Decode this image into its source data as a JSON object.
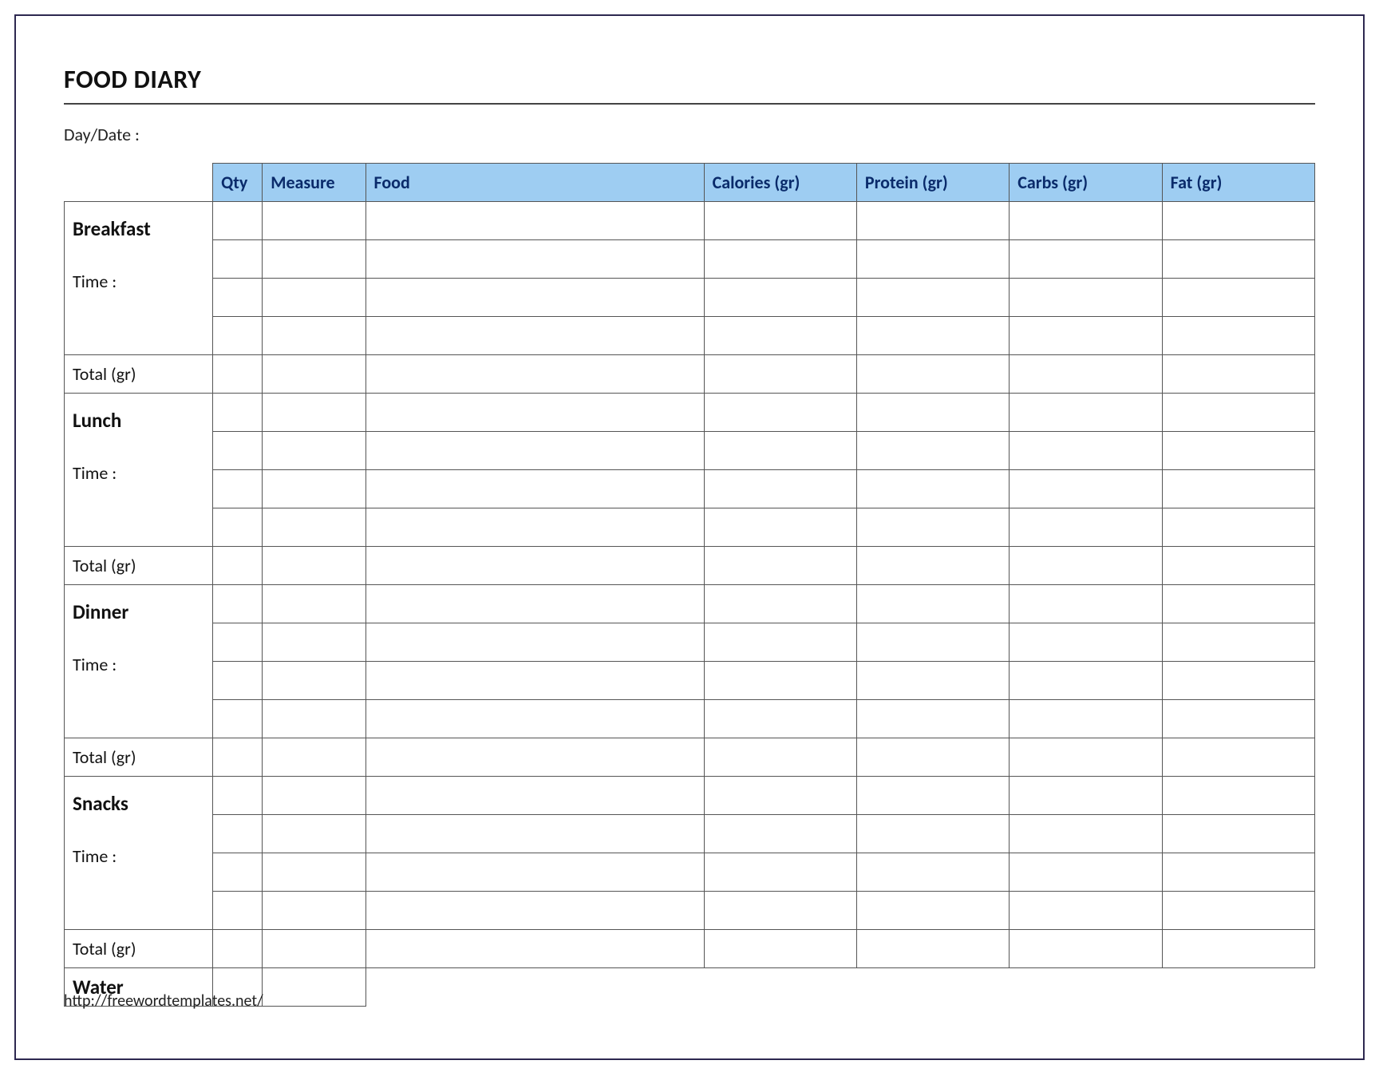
{
  "title": "FOOD DIARY",
  "daydate_label": "Day/Date :",
  "headers": {
    "qty": "Qty",
    "measure": "Measure",
    "food": "Food",
    "calories": "Calories (gr)",
    "protein": "Protein (gr)",
    "carbs": "Carbs (gr)",
    "fat": "Fat (gr)"
  },
  "meals": {
    "breakfast": "Breakfast",
    "lunch": "Lunch",
    "dinner": "Dinner",
    "snacks": "Snacks",
    "water": "Water"
  },
  "time_label": "Time :",
  "total_label": "Total (gr)",
  "footer": "http://freewordtemplates.net/"
}
